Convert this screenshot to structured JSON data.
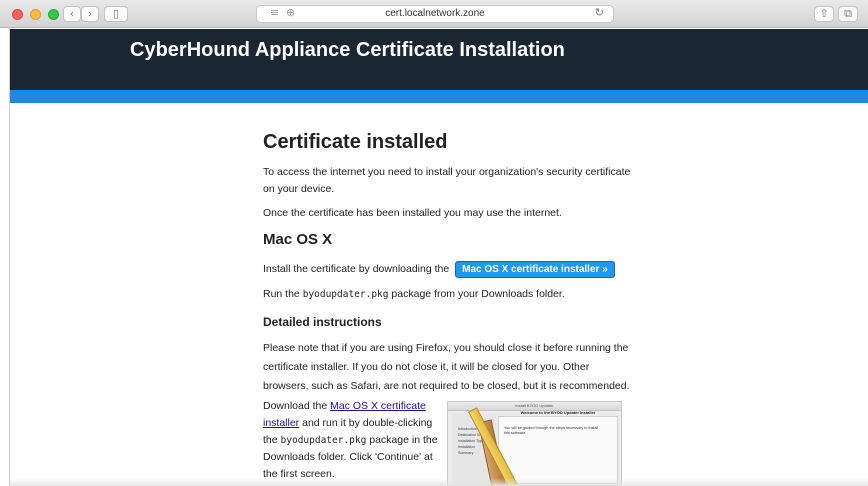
{
  "browser": {
    "url": "cert.localnetwork.zone",
    "icons": {
      "back": "chevron-left-icon",
      "forward": "chevron-right-icon",
      "sidebar": "sidebar-icon",
      "reader": "reader-icon",
      "site_settings": "globe-icon",
      "reload": "reload-icon",
      "share": "share-icon",
      "tabs": "tabs-icon"
    },
    "glyphs": {
      "back": "‹",
      "forward": "›",
      "sidebar": "▯",
      "reader": "≡",
      "site_settings": "⊕",
      "reload": "↻",
      "share": "⇧",
      "tabs": "⧉"
    }
  },
  "site": {
    "title": "CyberHound Appliance Certificate Installation",
    "header_color": "#1a2733",
    "accent_color": "#1e88e5"
  },
  "page": {
    "heading": "Certificate installed",
    "intro": "To access the internet you need to install your organization's security certificate on your device.",
    "after_install": "Once the certificate has been installed you may use the internet.",
    "mac_heading": "Mac OS X",
    "install_text": "Install the certificate by downloading the",
    "download_button": "Mac OS X certificate installer »",
    "run_prefix": "Run the",
    "package_name": "byodupdater.pkg",
    "run_suffix": "package from your Downloads folder.",
    "detailed_heading": "Detailed instructions",
    "firefox_note": "Please note that if you are using Firefox, you should close it before running the certificate installer. If you do not close it, it will be closed for you. Other browsers, such as Safari, are not required to be closed, but it is recommended.",
    "download_prefix": "Download the",
    "download_link": "Mac OS X certificate installer",
    "download_middle": "and run it by double-clicking the",
    "download_suffix": "package in the Downloads folder. Click 'Continue' at the first screen."
  },
  "installer_thumbnail": {
    "window_title": "Install BYOD Updater",
    "header": "Welcome to the BYOD Updater Installer",
    "steps": [
      "Introduction",
      "Destination Select",
      "Installation Type",
      "Installation",
      "Summary"
    ],
    "body": "You will be guided through the steps necessary to install this software."
  }
}
